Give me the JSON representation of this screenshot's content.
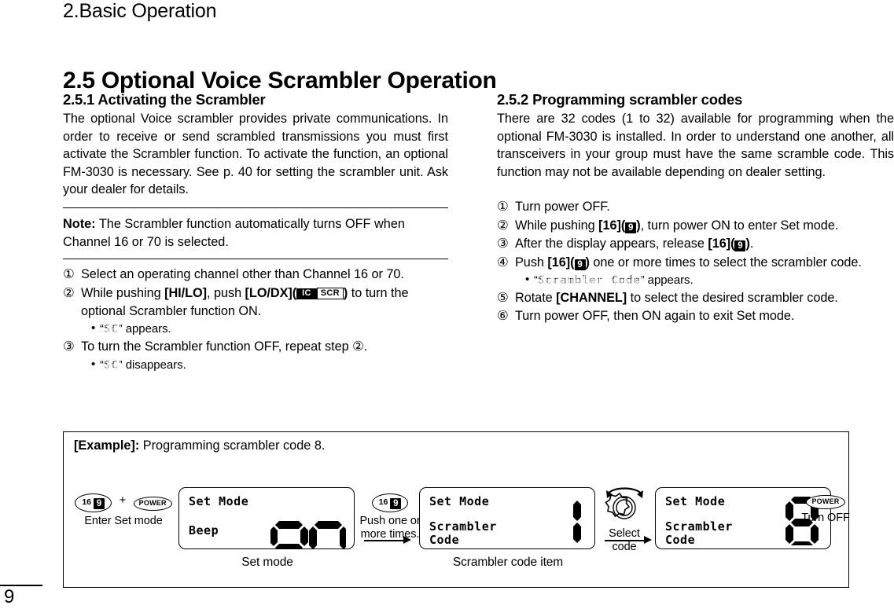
{
  "running_head": "2.Basic Operation",
  "section_title": "2.5 Optional Voice Scrambler Operation",
  "left_column": {
    "sub_head": "2.5.1 Activating the Scrambler",
    "intro": "The optional Voice scrambler provides private communications. In order to receive or send scrambled transmissions you must first activate the Scrambler function. To activate the function, an optional FM-3030 is necessary. See p. 40 for setting the scrambler unit. Ask your dealer for details.",
    "note_label": "Note:",
    "note_text": "The Scrambler function automatically turns OFF when Channel 16 or 70 is selected.",
    "steps": [
      {
        "num": "①",
        "text": "Select an operating channel other than Channel 16 or 70."
      },
      {
        "num": "②",
        "text_1": "While pushing ",
        "key_1": "[HI/LO]",
        "text_2": ", push ",
        "key_2": "[LO/DX]",
        "paren_open": "(",
        "badge_ic": "IC",
        "badge_scr": "SCR",
        "paren_close": ")",
        "text_3": " to turn the optional Scrambler function ON.",
        "bullet_dot": "•",
        "bullet_quote_open": "“",
        "bullet_lcd": "SC",
        "bullet_quote_close": "”",
        "bullet_tail": " appears."
      },
      {
        "num": "③",
        "text_1": "To turn the Scrambler function OFF, repeat step ",
        "ref": "②",
        "text_2": ".",
        "bullet_dot": "•",
        "bullet_quote_open": "“",
        "bullet_lcd": "SC",
        "bullet_quote_close": "”",
        "bullet_tail": " disappears."
      }
    ]
  },
  "right_column": {
    "sub_head": "2.5.2 Programming scrambler codes",
    "intro": "There are 32 codes (1 to 32) available for programming when the optional FM-3030 is installed. In order to understand one another, all transceivers in your group must have the same scramble code. This function may not be available depending on dealer setting.",
    "steps": [
      {
        "num": "①",
        "text": "Turn power OFF."
      },
      {
        "num": "②",
        "text_1": "While pushing ",
        "key_1": "[16]",
        "paren_open": "(",
        "badge_9": "9",
        "paren_close": ")",
        "text_2": ", turn power ON to enter Set mode."
      },
      {
        "num": "③",
        "text_1": "After the display appears, release ",
        "key_1": "[16]",
        "paren_open": "(",
        "badge_9": "9",
        "paren_close": ")",
        "text_2": "."
      },
      {
        "num": "④",
        "text_1": "Push ",
        "key_1": "[16]",
        "paren_open": "(",
        "badge_9": "9",
        "paren_close": ")",
        "text_2": " one or more times to select the scrambler code.",
        "bullet_dot": "•",
        "bullet_quote_open": "“",
        "bullet_lcd": "Scrambler Code",
        "bullet_quote_close": "”",
        "bullet_tail": " appears."
      },
      {
        "num": "⑤",
        "text_1": "Rotate ",
        "key_1": "[CHANNEL]",
        "text_2": " to select the desired scrambler code."
      },
      {
        "num": "⑥",
        "text": "Turn power OFF, then ON again to exit Set mode."
      }
    ]
  },
  "example": {
    "label": "[Example]:",
    "title": " Programming scrambler code 8.",
    "step1": {
      "key_16": "16",
      "key_9": "9",
      "plus": "+",
      "power": "POWER",
      "caption": "Enter Set mode"
    },
    "panel1": {
      "line1": "Set Mode",
      "line2": "Beep",
      "value": "on",
      "caption": "Set mode"
    },
    "step2": {
      "key_16": "16",
      "key_9": "9",
      "caption_line1": "Push one or",
      "caption_line2": "more times."
    },
    "panel2": {
      "line1": "Set Mode",
      "line2": "Scrambler",
      "line3": "Code",
      "value": "1",
      "caption": "Scrambler code item"
    },
    "knob": {
      "caption": "Select code"
    },
    "panel3": {
      "line1": "Set Mode",
      "line2": "Scrambler",
      "line3": "Code",
      "value": "8"
    },
    "step3": {
      "power": "POWER",
      "caption": "Turn OFF"
    }
  },
  "folio": "9"
}
